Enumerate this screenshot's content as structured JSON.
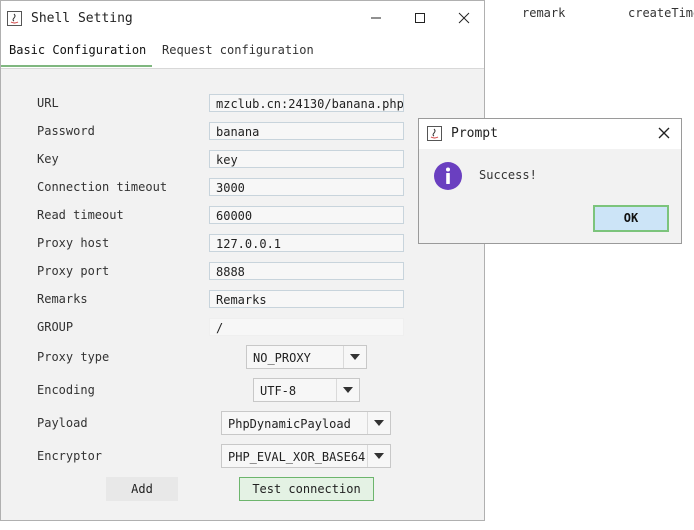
{
  "background": {
    "columns": [
      "remark",
      "createTime"
    ]
  },
  "window": {
    "title": "Shell Setting",
    "tabs": [
      {
        "label": "Basic Configuration"
      },
      {
        "label": "Request configuration"
      }
    ]
  },
  "form": {
    "url_label": "URL",
    "url_value": "mzclub.cn:24130/banana.php",
    "password_label": "Password",
    "password_value": "banana",
    "key_label": "Key",
    "key_value": "key",
    "conn_timeout_label": "Connection timeout",
    "conn_timeout_value": "3000",
    "read_timeout_label": "Read timeout",
    "read_timeout_value": "60000",
    "proxy_host_label": "Proxy host",
    "proxy_host_value": "127.0.0.1",
    "proxy_port_label": "Proxy port",
    "proxy_port_value": "8888",
    "remarks_label": "Remarks",
    "remarks_value": "Remarks",
    "group_label": "GROUP",
    "group_value": "/",
    "proxy_type_label": "Proxy type",
    "proxy_type_value": "NO_PROXY",
    "encoding_label": "Encoding",
    "encoding_value": "UTF-8",
    "payload_label": "Payload",
    "payload_value": "PhpDynamicPayload",
    "encryptor_label": "Encryptor",
    "encryptor_value": "PHP_EVAL_XOR_BASE64",
    "add_label": "Add",
    "test_label": "Test connection"
  },
  "dialog": {
    "title": "Prompt",
    "message": "Success!",
    "ok_label": "OK",
    "icon": "info-icon"
  },
  "colors": {
    "accent_green": "#6db56d",
    "info_purple": "#6a3fc0",
    "ok_blue": "#cce4f7"
  }
}
